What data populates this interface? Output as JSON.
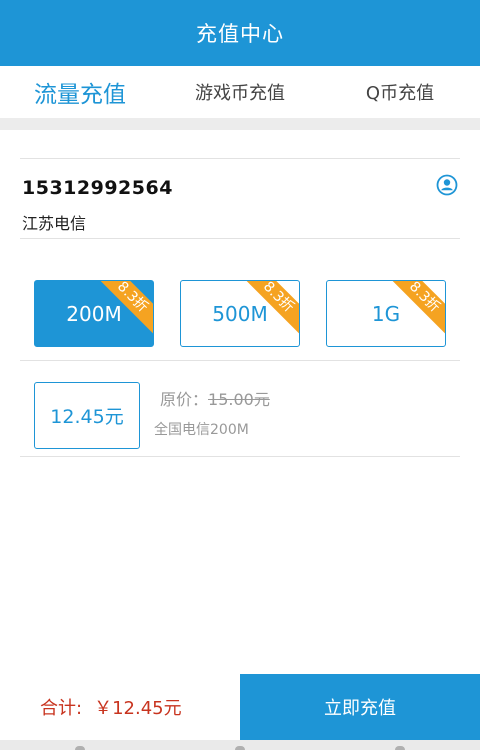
{
  "header": {
    "title": "充值中心"
  },
  "tabs": [
    {
      "label": "流量充值",
      "active": true
    },
    {
      "label": "游戏币充值",
      "active": false
    },
    {
      "label": "Q币充值",
      "active": false
    }
  ],
  "account": {
    "phone": "15312992564",
    "carrier": "江苏电信",
    "contact_icon": "contact-icon"
  },
  "packages": [
    {
      "label": "200M",
      "discount": "8.3折",
      "selected": true
    },
    {
      "label": "500M",
      "discount": "8.3折",
      "selected": false
    },
    {
      "label": "1G",
      "discount": "8.3折",
      "selected": false
    }
  ],
  "price": {
    "current": "12.45元",
    "original_label": "原价：",
    "original_value": "15.00元",
    "description": "全国电信200M"
  },
  "footer": {
    "total_label": "合计:",
    "total_value": "￥12.45元",
    "pay_button": "立即充值"
  },
  "colors": {
    "primary": "#1e95d6",
    "ribbon": "#f5a321",
    "total": "#c8341f"
  }
}
